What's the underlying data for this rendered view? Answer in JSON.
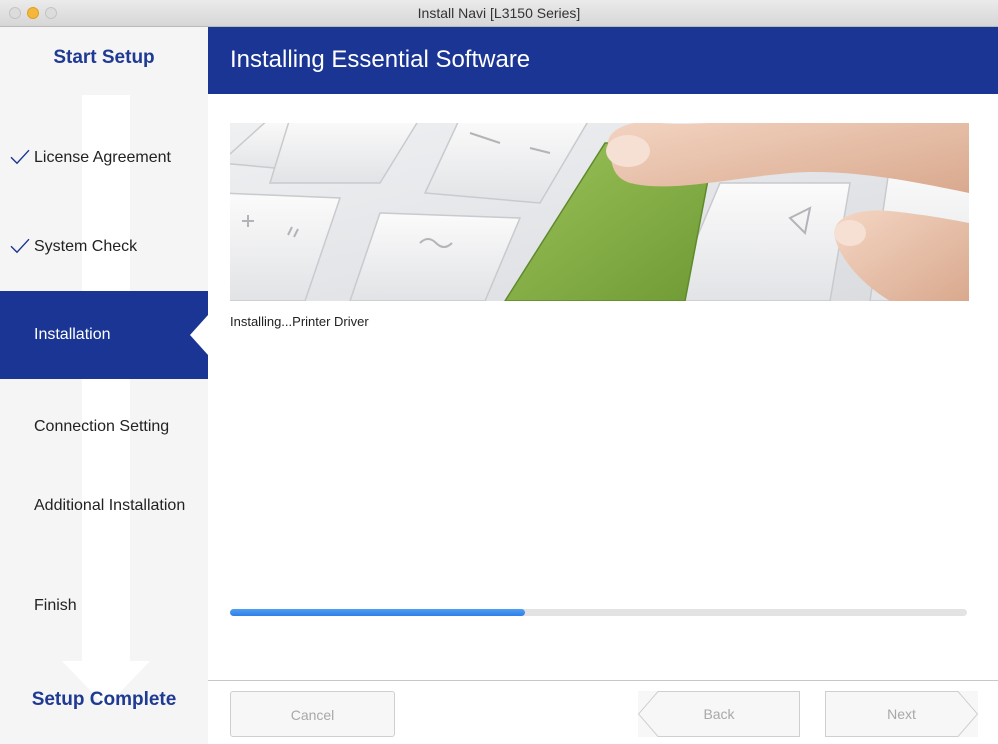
{
  "window": {
    "title": "Install Navi [L3150 Series]"
  },
  "sidebar": {
    "start_label": "Start Setup",
    "complete_label": "Setup Complete",
    "steps": [
      {
        "label": "License Agreement",
        "done": true
      },
      {
        "label": "System Check",
        "done": true
      },
      {
        "label": "Installation",
        "active": true
      },
      {
        "label": "Connection Setting"
      },
      {
        "label": "Additional Installation"
      },
      {
        "label": "Finish"
      }
    ]
  },
  "header": {
    "title": "Installing Essential Software"
  },
  "main": {
    "status_text": "Installing...Printer Driver",
    "progress_fraction": 0.4,
    "accent_color": "#1a3593",
    "progress_color": "#2f80e8"
  },
  "footer": {
    "cancel_label": "Cancel",
    "back_label": "Back",
    "next_label": "Next"
  }
}
